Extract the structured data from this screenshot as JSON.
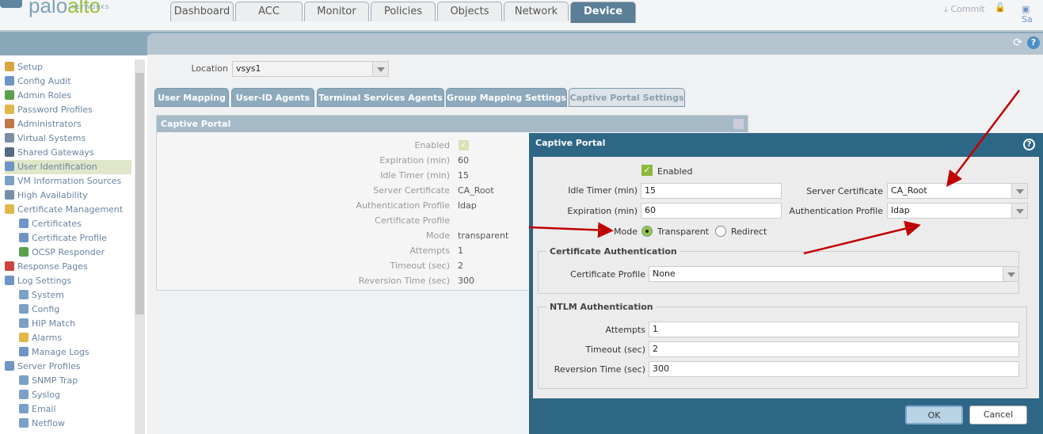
{
  "header": {
    "logo": "paloalto",
    "logo_sub": "NETWORKS",
    "commit": "Commit",
    "save": "Sa"
  },
  "tabs": [
    "Dashboard",
    "ACC",
    "Monitor",
    "Policies",
    "Objects",
    "Network",
    "Device"
  ],
  "active_tab": "Device",
  "sidebar": [
    {
      "label": "Setup",
      "color": "#d9a640",
      "indent": 0
    },
    {
      "label": "Config Audit",
      "color": "#6f94c6",
      "indent": 0
    },
    {
      "label": "Admin Roles",
      "color": "#5aa04b",
      "indent": 0
    },
    {
      "label": "Password Profiles",
      "color": "#e0b84a",
      "indent": 0
    },
    {
      "label": "Administrators",
      "color": "#c0784a",
      "indent": 0
    },
    {
      "label": "Virtual Systems",
      "color": "#7a8ea8",
      "indent": 0
    },
    {
      "label": "Shared Gateways",
      "color": "#556b80",
      "indent": 0
    },
    {
      "label": "User Identification",
      "color": "#6f94c6",
      "indent": 0,
      "selected": true
    },
    {
      "label": "VM Information Sources",
      "color": "#7aa0c8",
      "indent": 0
    },
    {
      "label": "High Availability",
      "color": "#7a8ea8",
      "indent": 0
    },
    {
      "label": "Certificate Management",
      "color": "#e0b84a",
      "indent": 0,
      "expander": true
    },
    {
      "label": "Certificates",
      "color": "#6f94c6",
      "indent": 1
    },
    {
      "label": "Certificate Profile",
      "color": "#6f94c6",
      "indent": 1
    },
    {
      "label": "OCSP Responder",
      "color": "#5aa04b",
      "indent": 1
    },
    {
      "label": "Response Pages",
      "color": "#d04040",
      "indent": 0
    },
    {
      "label": "Log Settings",
      "color": "#6f94c6",
      "indent": 0,
      "expander": true
    },
    {
      "label": "System",
      "color": "#7aa0c8",
      "indent": 1
    },
    {
      "label": "Config",
      "color": "#7aa0c8",
      "indent": 1
    },
    {
      "label": "HIP Match",
      "color": "#7aa0c8",
      "indent": 1
    },
    {
      "label": "Alarms",
      "color": "#e0b84a",
      "indent": 1
    },
    {
      "label": "Manage Logs",
      "color": "#6f94c6",
      "indent": 1
    },
    {
      "label": "Server Profiles",
      "color": "#6f94c6",
      "indent": 0,
      "expander": true
    },
    {
      "label": "SNMP Trap",
      "color": "#7aa0c8",
      "indent": 1
    },
    {
      "label": "Syslog",
      "color": "#7aa0c8",
      "indent": 1
    },
    {
      "label": "Email",
      "color": "#7aa0c8",
      "indent": 1
    },
    {
      "label": "Netflow",
      "color": "#7aa0c8",
      "indent": 1
    }
  ],
  "location": {
    "label": "Location",
    "value": "vsys1"
  },
  "subtabs": [
    "User Mapping",
    "User-ID Agents",
    "Terminal Services Agents",
    "Group Mapping Settings",
    "Captive Portal Settings"
  ],
  "panel": {
    "title": "Captive Portal",
    "rows": [
      {
        "label": "Enabled",
        "value": ""
      },
      {
        "label": "Expiration (min)",
        "value": "60"
      },
      {
        "label": "Idle Timer (min)",
        "value": "15"
      },
      {
        "label": "Server Certificate",
        "value": "CA_Root"
      },
      {
        "label": "Authentication Profile",
        "value": "ldap"
      },
      {
        "label": "Certificate Profile",
        "value": ""
      },
      {
        "label": "Mode",
        "value": "transparent"
      },
      {
        "label": "Attempts",
        "value": "1"
      },
      {
        "label": "Timeout (sec)",
        "value": "2"
      },
      {
        "label": "Reversion Time (sec)",
        "value": "300"
      }
    ]
  },
  "dialog": {
    "title": "Captive Portal",
    "enabled": "Enabled",
    "idle_label": "Idle Timer (min)",
    "idle": "15",
    "exp_label": "Expiration (min)",
    "exp": "60",
    "mode_label": "Mode",
    "mode_transparent": "Transparent",
    "mode_redirect": "Redirect",
    "servercert_label": "Server Certificate",
    "servercert": "CA_Root",
    "authprof_label": "Authentication Profile",
    "authprof": "ldap",
    "certauth_legend": "Certificate Authentication",
    "certprof_label": "Certificate Profile",
    "certprof": "None",
    "ntlm_legend": "NTLM Authentication",
    "attempts_label": "Attempts",
    "attempts": "1",
    "timeout_label": "Timeout (sec)",
    "timeout": "2",
    "rev_label": "Reversion Time (sec)",
    "rev": "300",
    "ok": "OK",
    "cancel": "Cancel"
  },
  "colors": {
    "dialog": "#2e6686",
    "arrow": "#c00000",
    "accent": "#9cbf3b"
  }
}
